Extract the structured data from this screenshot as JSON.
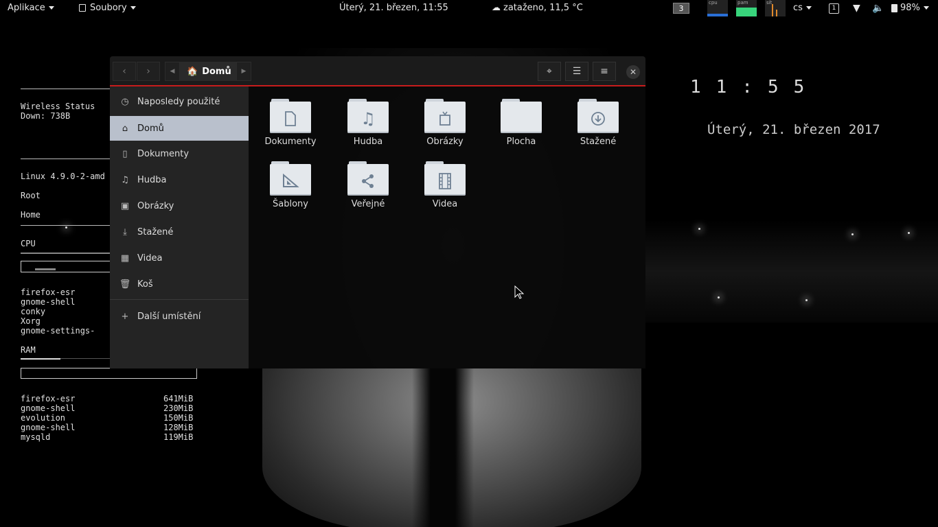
{
  "topbar": {
    "apps_label": "Aplikace",
    "places_label": "Soubory",
    "datetime": "Úterý, 21. březen, 11:55",
    "weather": "zataženo, 11,5 °C",
    "workspace": "3",
    "gauges": [
      "cpu",
      "pam",
      "sít"
    ],
    "language": "cs",
    "workspace_indicator": "1",
    "battery": "98%"
  },
  "conky": {
    "wireless_title": "Wireless Status",
    "wireless_down": "Down: 738B",
    "kernel": "Linux 4.9.0-2-amd",
    "root_label": "Root",
    "home_label": "Home",
    "cpu_label": "CPU",
    "cpu_procs": [
      "firefox-esr",
      "gnome-shell",
      "conky",
      "Xorg",
      "gnome-settings-"
    ],
    "ram_label": "RAM",
    "ram_procs": [
      {
        "name": "firefox-esr",
        "mem": "641MiB"
      },
      {
        "name": "gnome-shell",
        "mem": "230MiB"
      },
      {
        "name": "evolution",
        "mem": "150MiB"
      },
      {
        "name": "gnome-shell",
        "mem": "128MiB"
      },
      {
        "name": "mysqld",
        "mem": "119MiB"
      }
    ]
  },
  "clock": {
    "time": "11:55",
    "date": "Úterý, 21. březen 2017"
  },
  "filemanager": {
    "path": "Domů",
    "sidebar": [
      {
        "label": "Naposledy použité",
        "icon": "clock-icon"
      },
      {
        "label": "Domů",
        "icon": "home-icon",
        "active": true
      },
      {
        "label": "Dokumenty",
        "icon": "document-icon"
      },
      {
        "label": "Hudba",
        "icon": "music-icon"
      },
      {
        "label": "Obrázky",
        "icon": "picture-icon"
      },
      {
        "label": "Stažené",
        "icon": "download-icon"
      },
      {
        "label": "Videa",
        "icon": "film-icon"
      },
      {
        "label": "Koš",
        "icon": "trash-icon"
      },
      {
        "label": "Další umístění",
        "icon": "plus-icon"
      }
    ],
    "folders": [
      {
        "label": "Dokumenty",
        "icon": "document-icon"
      },
      {
        "label": "Hudba",
        "icon": "music-icon"
      },
      {
        "label": "Obrázky",
        "icon": "picture-icon"
      },
      {
        "label": "Plocha",
        "icon": "none"
      },
      {
        "label": "Stažené",
        "icon": "download-icon"
      },
      {
        "label": "Šablony",
        "icon": "template-icon"
      },
      {
        "label": "Veřejné",
        "icon": "share-icon"
      },
      {
        "label": "Videa",
        "icon": "film-icon"
      }
    ]
  },
  "colors": {
    "accent": "#c81c1c",
    "sidebar_active": "#b9c0cc",
    "folder": "#e4e8ec"
  }
}
